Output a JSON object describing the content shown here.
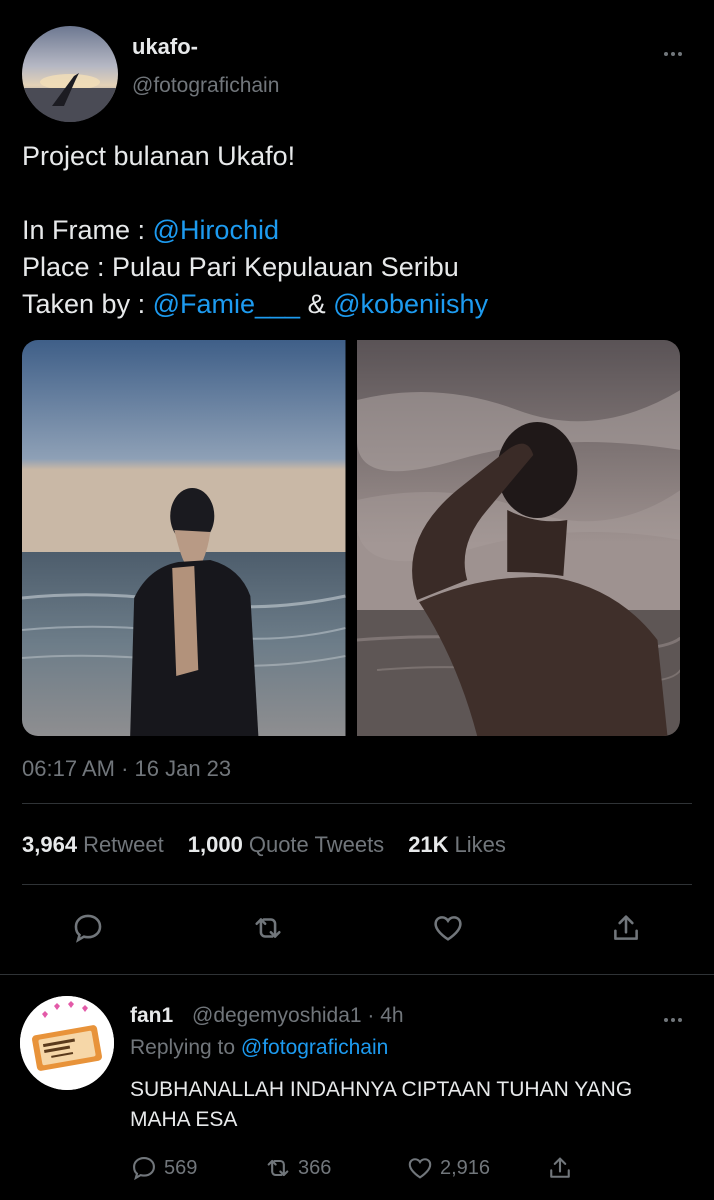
{
  "tweet": {
    "author": {
      "display_name": "ukafo-",
      "handle": "@fotografichain",
      "avatar_icon": "sunset-hand-avatar"
    },
    "text": {
      "line1": "Project bulanan Ukafo!",
      "in_frame_label": "In Frame : ",
      "in_frame_mention": "@Hirochid",
      "place": "Place : Pulau Pari Kepulauan Seribu",
      "taken_by_label": "Taken by : ",
      "taken_by_mention1": "@Famie___",
      "taken_by_amp": " & ",
      "taken_by_mention2": "@kobeniishy"
    },
    "timestamp": "06:17 AM · 16 Jan 23",
    "stats": {
      "retweets": {
        "value": "3,964",
        "label": "Retweet"
      },
      "quotes": {
        "value": "1,000",
        "label": "Quote Tweets"
      },
      "likes": {
        "value": "21K",
        "label": "Likes"
      }
    },
    "actions": [
      "reply-icon",
      "retweet-icon",
      "like-icon",
      "share-icon"
    ]
  },
  "reply": {
    "display_name": "fan1",
    "meta": "@degemyoshida1 · 4h",
    "replying_label": "Replying to ",
    "replying_mention": "@fotografichain",
    "text": "SUBHANALLAH INDAHNYA CIPTAAN TUHAN YANG MAHA ESA",
    "counts": {
      "reply": "569",
      "retweet": "366",
      "like": "2,916"
    }
  },
  "colors": {
    "background": "#000000",
    "text": "#e7e9ea",
    "muted": "#71767b",
    "link": "#1d9bf0",
    "divider": "#2f3336"
  }
}
